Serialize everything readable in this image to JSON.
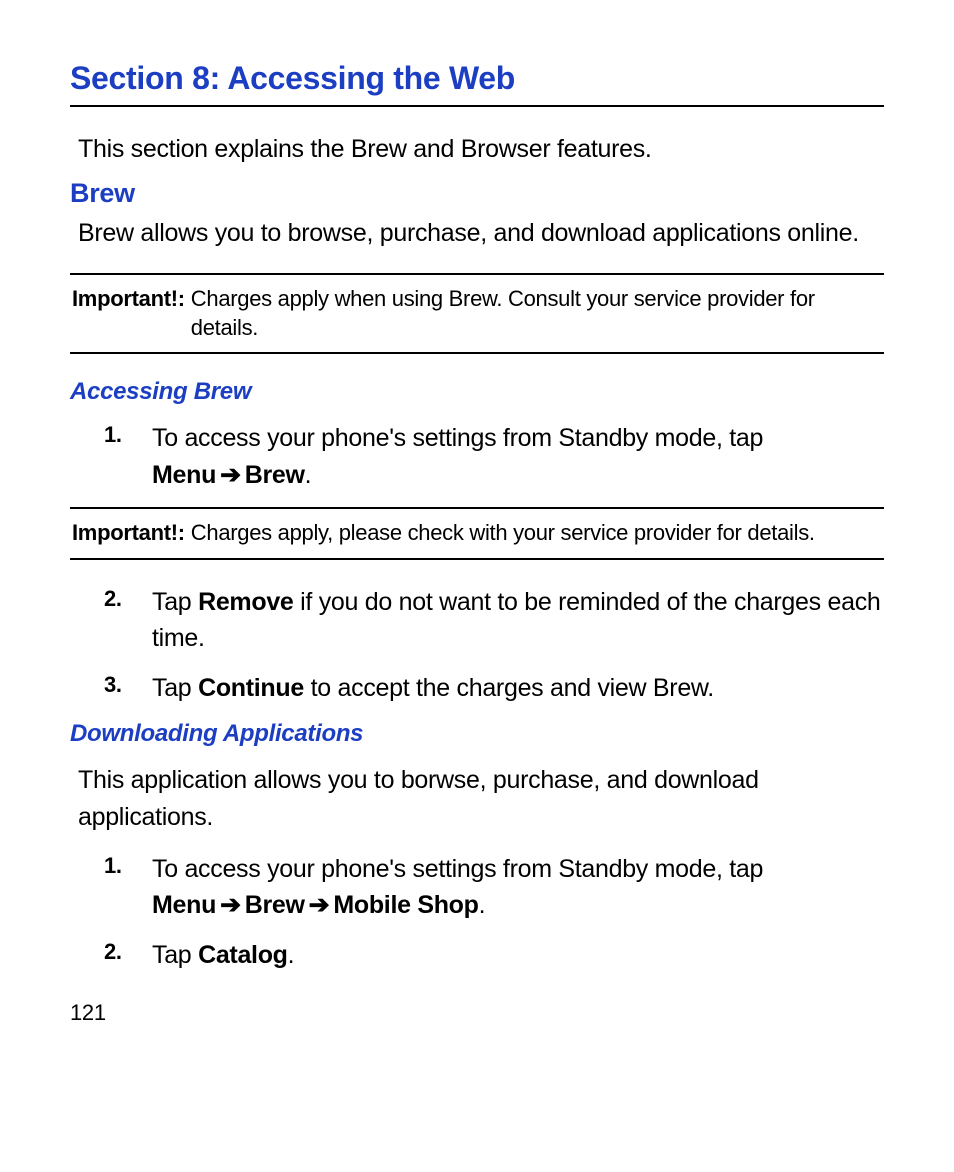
{
  "section_title": "Section 8: Accessing the Web",
  "intro": "This section explains the Brew and Browser features.",
  "brew": {
    "heading": "Brew",
    "para": "Brew allows you to browse, purchase, and download applications online.",
    "important1": {
      "label": "Important!:",
      "text": "Charges apply when using Brew. Consult your service provider for details."
    },
    "accessing": {
      "heading": "Accessing Brew",
      "step1": {
        "num": "1.",
        "pre": "To access your phone's settings from Standby mode, tap ",
        "menu": "Menu",
        "arrow": "➔",
        "brew": "Brew",
        "post": "."
      }
    },
    "important2": {
      "label": "Important!:",
      "text": "Charges apply, please check with your service provider for details."
    },
    "step2": {
      "num": "2.",
      "pre": "Tap ",
      "bold": "Remove",
      "post": " if you do not want to be reminded of the charges each time."
    },
    "step3": {
      "num": "3.",
      "pre": "Tap ",
      "bold": "Continue",
      "post": " to accept the charges and view Brew."
    }
  },
  "downloading": {
    "heading": "Downloading Applications",
    "para": "This application allows you to borwse, purchase, and download applications.",
    "step1": {
      "num": "1.",
      "pre": "To access your phone's settings from Standby mode, tap ",
      "menu": "Menu",
      "arrow1": "➔",
      "brew": "Brew",
      "arrow2": "➔",
      "shop": "Mobile Shop",
      "post": "."
    },
    "step2": {
      "num": "2.",
      "pre": "Tap ",
      "bold": "Catalog",
      "post": "."
    }
  },
  "page_number": "121"
}
